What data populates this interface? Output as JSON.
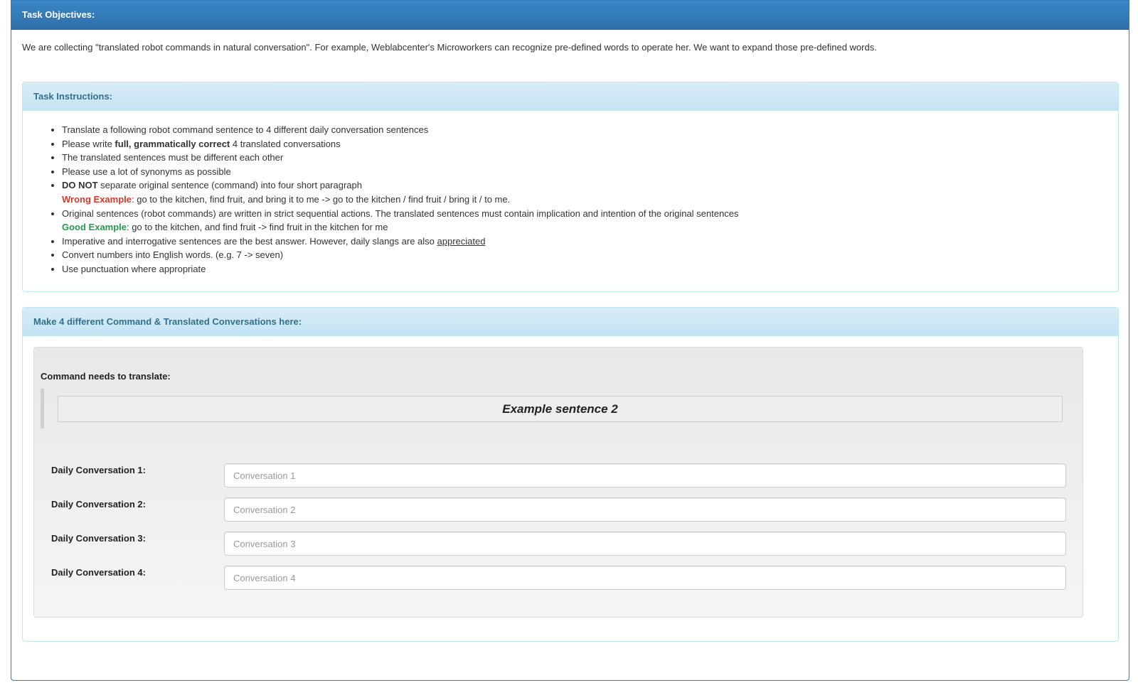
{
  "objectives": {
    "title": "Task Objectives:",
    "text": "We are collecting \"translated robot commands in natural conversation\". For example, Weblabcenter's Microworkers can recognize pre-defined words to operate her. We want to expand those pre-defined words."
  },
  "instructions": {
    "title": "Task Instructions:",
    "item1": "Translate a following robot command sentence to 4 different daily conversation sentences",
    "item2_pre": "Please write ",
    "item2_bold": "full, grammatically correct",
    "item2_post": " 4 translated conversations",
    "item3": "The translated sentences must be different each other",
    "item4": "Please use a lot of synonyms as possible",
    "item5_bold": "DO NOT",
    "item5_text": " separate original sentence (command) into four short paragraph",
    "wrong_label": "Wrong Example",
    "wrong_text": ": go to the kitchen, find fruit, and bring it to me -> go to the kitchen / find fruit / bring it / to me.",
    "item6": "Original sentences (robot commands) are written in strict sequential actions. The translated sentences must contain implication and intention of the original sentences",
    "good_label": "Good Example",
    "good_text": ": go to the kitchen, and find fruit -> find fruit in the kitchen for me",
    "item7_pre": "Imperative and interrogative sentences are the best answer. However, daily slangs are also ",
    "item7_link": "appreciated",
    "item8": "Convert numbers into English words. (e.g. 7 -> seven)",
    "item9": "Use punctuation where appropriate"
  },
  "make": {
    "title": "Make 4 different Command & Translated Conversations here:",
    "command_label": "Command needs to translate:",
    "command_sentence": "Example sentence 2",
    "rows": [
      {
        "label": "Daily Conversation 1:",
        "placeholder": "Conversation 1"
      },
      {
        "label": "Daily Conversation 2:",
        "placeholder": "Conversation 2"
      },
      {
        "label": "Daily Conversation 3:",
        "placeholder": "Conversation 3"
      },
      {
        "label": "Daily Conversation 4:",
        "placeholder": "Conversation 4"
      }
    ]
  },
  "colors": {
    "primary_header": "#337ab7",
    "info_header_text": "#31708f",
    "wrong": "#d9392b",
    "good": "#1e9e4b"
  }
}
